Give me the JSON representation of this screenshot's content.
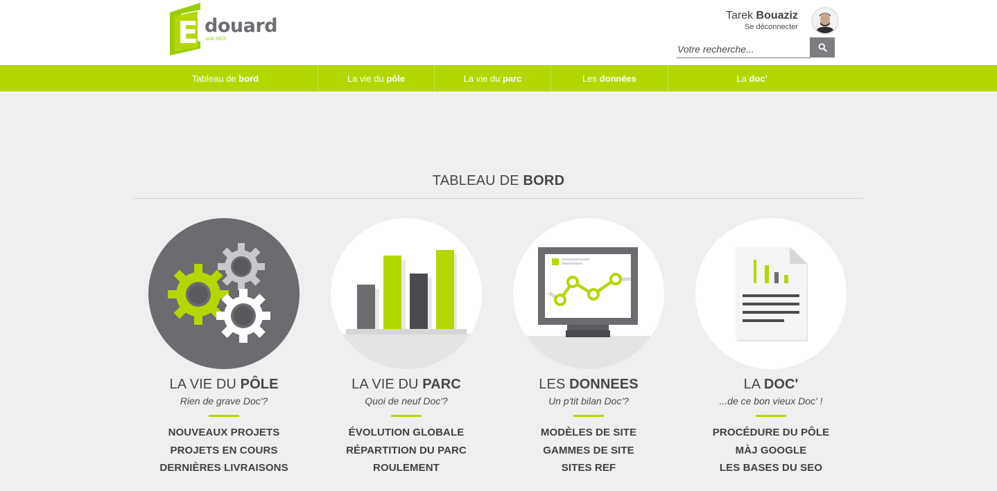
{
  "header": {
    "logo_word": "douard",
    "logo_letter": "E",
    "logo_tagline": "outil SEO",
    "user_first": "Tarek",
    "user_last": "Bouaziz",
    "logout_label": "Se déconnecter",
    "search_placeholder": "Votre recherche...",
    "search_icon": "search-icon"
  },
  "nav": {
    "items": [
      {
        "pre": "Tableau de",
        "bold": "bord"
      },
      {
        "pre": "La vie du",
        "bold": "pôle"
      },
      {
        "pre": "La vie du",
        "bold": "parc"
      },
      {
        "pre": "Les",
        "bold": "données"
      },
      {
        "pre": "La",
        "bold": "doc'"
      }
    ]
  },
  "main": {
    "title_pre": "TABLEAU DE",
    "title_bold": "BORD",
    "cards": [
      {
        "icon": "gears-icon",
        "title_pre": "LA VIE DU",
        "title_bold": "PÔLE",
        "subtitle": "Rien de grave Doc'?",
        "links": [
          "NOUVEAUX PROJETS",
          "PROJETS EN COURS",
          "DERNIÈRES LIVRAISONS"
        ]
      },
      {
        "icon": "bar-chart-icon",
        "title_pre": "LA VIE DU",
        "title_bold": "PARC",
        "subtitle": "Quoi de neuf Doc'?",
        "links": [
          "ÉVOLUTION GLOBALE",
          "RÉPARTITION DU PARC",
          "ROULEMENT"
        ]
      },
      {
        "icon": "monitor-chart-icon",
        "title_pre": "LES",
        "title_bold": "DONNEES",
        "subtitle": "Un p'tit bilan Doc'?",
        "links": [
          "MODÈLES DE SITE",
          "GAMMES DE SITE",
          "SITES REF"
        ]
      },
      {
        "icon": "document-icon",
        "title_pre": "LA",
        "title_bold": "DOC'",
        "subtitle": "...de ce bon vieux Doc' !",
        "links": [
          "PROCÉDURE DU PÔLE",
          "MÀJ GOOGLE",
          "LES BASES DU SEO"
        ]
      }
    ]
  },
  "colors": {
    "accent": "#b2d800",
    "dark_gray": "#4a4a4f",
    "mid_gray": "#6b6b70",
    "background": "#efefef"
  }
}
